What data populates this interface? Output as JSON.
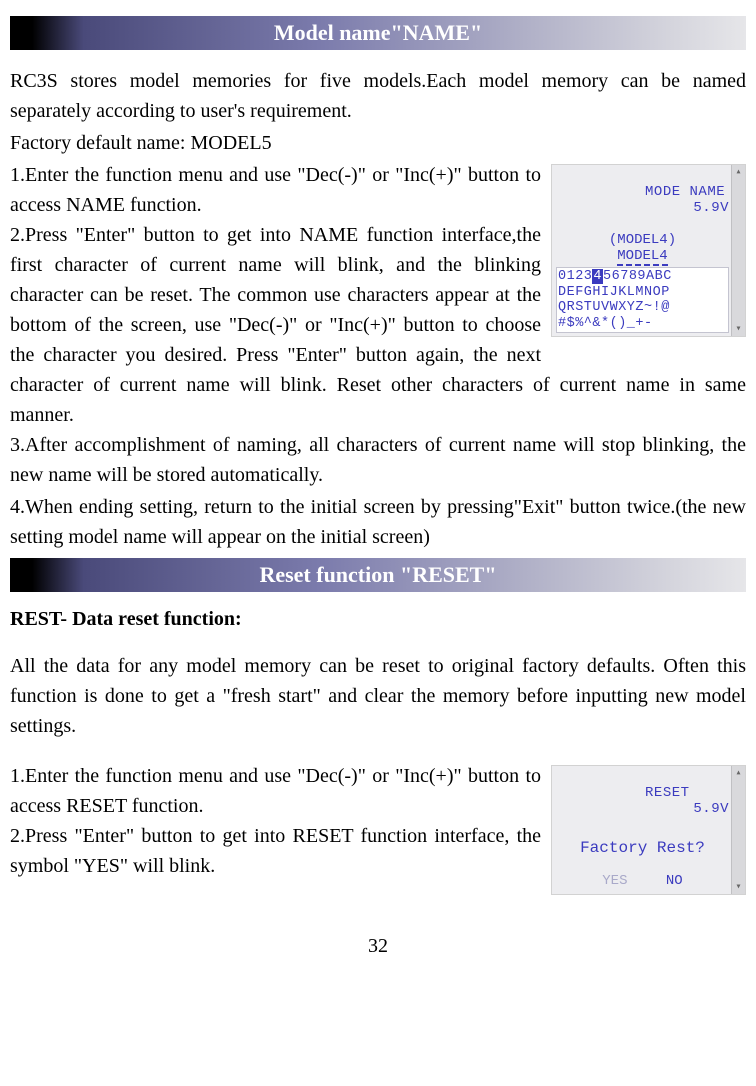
{
  "header1": "Model name\"NAME\"",
  "intro1a": "RC3S stores model memories for five models.Each model memory can be named separately according to user's requirement.",
  "intro1b": "Factory default name: MODEL5",
  "name_steps_wrap": "1.Enter the function menu and use  \"Dec(-)\" or \"Inc(+)\" button to access NAME function.",
  "name_step2a": "2.Press \"Enter\" button to get into NAME function interface,the first character of current name will blink, and the blinking character can be reset. The common use characters appear at the bottom of the screen, use \"Dec(-)\" or \"Inc(+)\" button to choose the character you desired. Press \"Enter\" button again, the next character of current name will blink. Reset other characters of current name in same manner.",
  "name_step3": "3.After accomplishment of naming, all characters of current name will stop blinking, the new name will be stored automatically.",
  "name_step4": "4.When ending setting, return to the initial screen by pressing\"Exit\" button twice.(the new setting model name will appear on the initial screen)",
  "header2": "Reset function \"RESET\"",
  "rest_head": "REST- Data reset function:",
  "rest_intro": "All the data for any model memory can be reset to original factory defaults. Often this function is done to get a \"fresh start\" and clear the memory before inputting new model settings.",
  "rest_step1": "1.Enter the function menu and use  \"Dec(-)\" or \"Inc(+)\" button to access RESET function.",
  "rest_step2": "2.Press \"Enter\" button to get into RESET function interface, the symbol \"YES\" will blink.",
  "lcd1": {
    "title": "MODE NAME",
    "volt": "5.9V",
    "sub1": "(MODEL4)",
    "sub2_pre": "MODEL",
    "sub2_hl": "4",
    "row1_a": "0123",
    "row1_hl": "4",
    "row1_b": "56789ABC",
    "row2": "DEFGHIJKLMNOP",
    "row3": "QRSTUVWXYZ~!@",
    "row4": "#$%^&*()_+-"
  },
  "lcd2": {
    "title": "RESET",
    "volt": "5.9V",
    "msg": "Factory Rest?",
    "yes": "YES",
    "no": "NO"
  },
  "page_number": "32"
}
